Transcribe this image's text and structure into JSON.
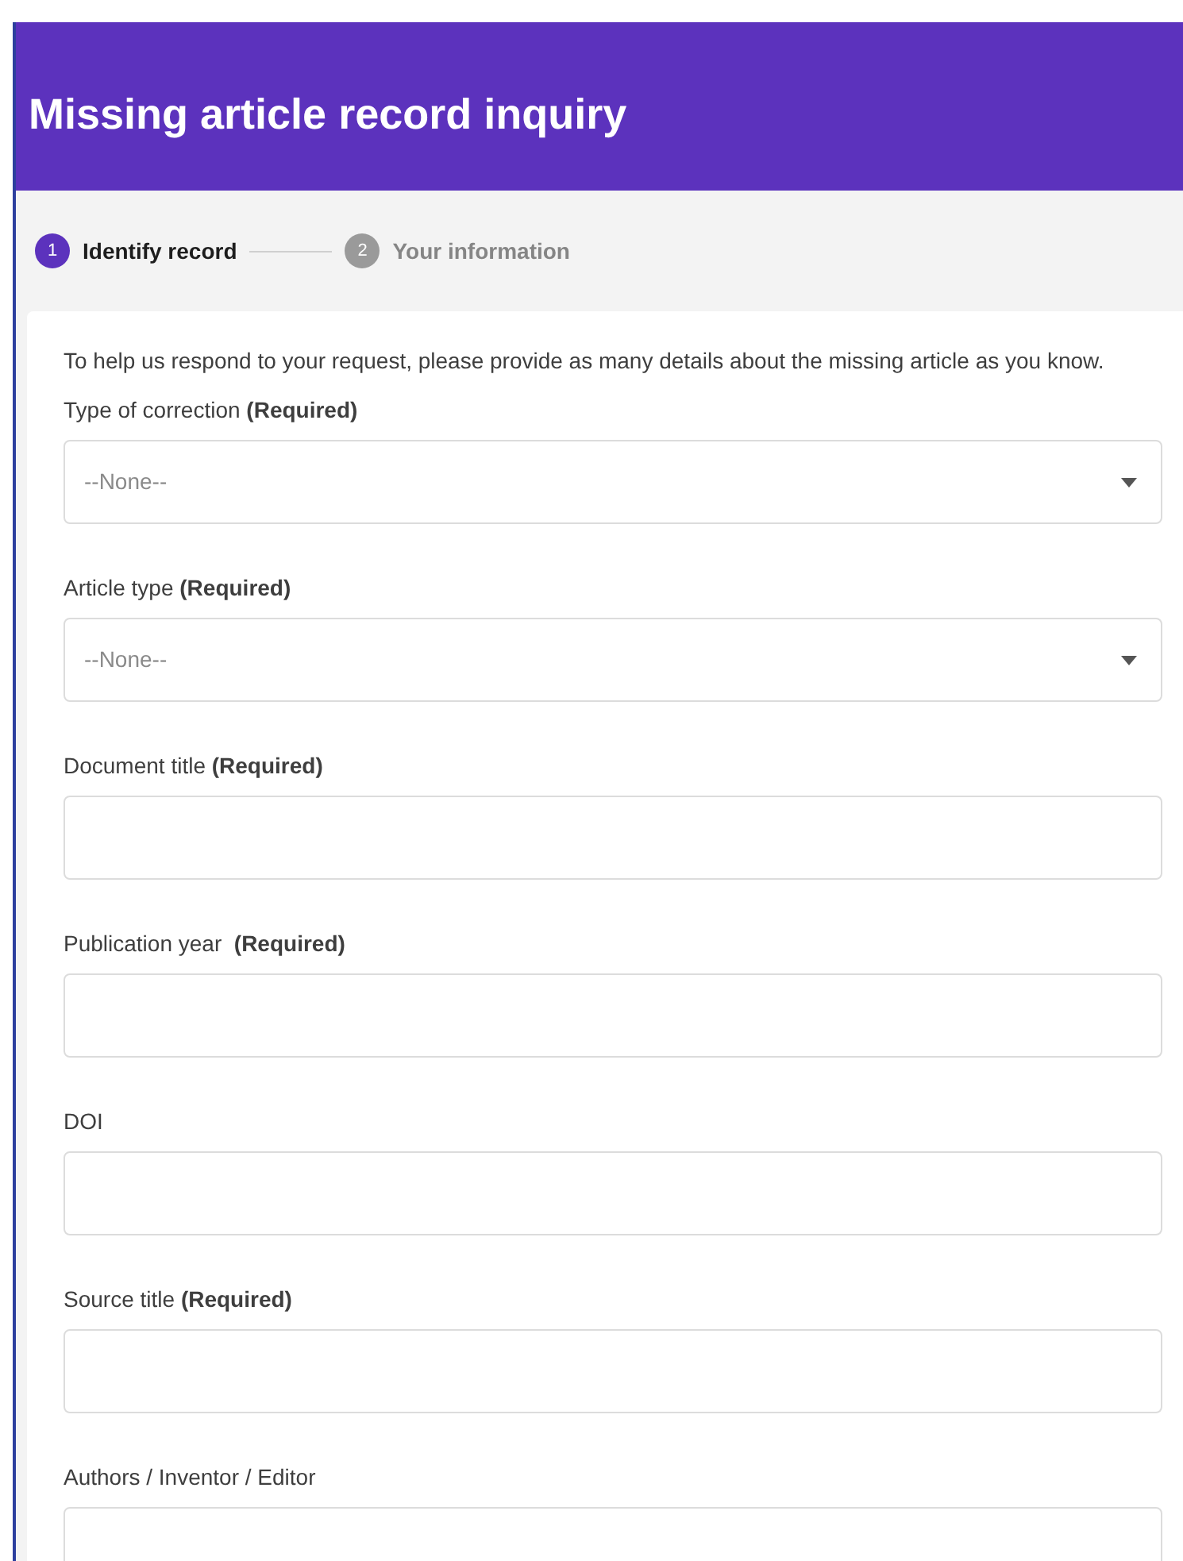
{
  "header": {
    "title": "Missing article record inquiry"
  },
  "steps": [
    {
      "number": "1",
      "label": "Identify record",
      "selected": true
    },
    {
      "number": "2",
      "label": "Your information",
      "selected": false
    }
  ],
  "intro": "To help us respond to your request, please provide as many details about the missing article as you know.",
  "fields": [
    {
      "kind": "select",
      "label": "Type of correction **(Required)**",
      "placeholder": "--None--"
    },
    {
      "kind": "select",
      "label": "Article type **(Required)**",
      "placeholder": "--None--"
    },
    {
      "kind": "text",
      "label": "Document title **(Required)**"
    },
    {
      "kind": "text",
      "label": "Publication year  **(Required)**"
    },
    {
      "kind": "text",
      "label": "DOI"
    },
    {
      "kind": "text",
      "label": "Source title **(Required)**"
    },
    {
      "kind": "text",
      "label": "Authors / Inventor / Editor"
    }
  ]
}
